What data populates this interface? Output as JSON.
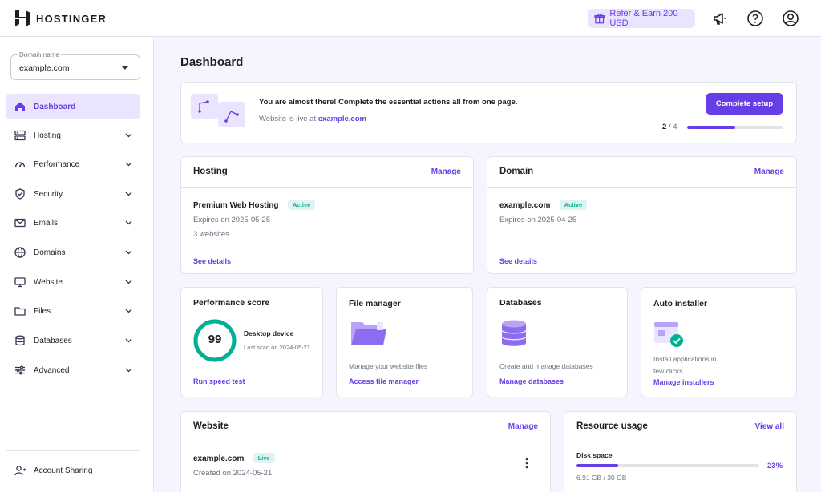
{
  "brand": {
    "name": "HOSTINGER"
  },
  "topbar": {
    "refer_label": "Refer & Earn 200 USD"
  },
  "sidebar": {
    "domain_select": {
      "label": "Domain name",
      "value": "example.com"
    },
    "items": [
      {
        "label": "Dashboard",
        "icon": "home-icon",
        "active": true
      },
      {
        "label": "Hosting",
        "icon": "server-icon"
      },
      {
        "label": "Performance",
        "icon": "gauge-icon"
      },
      {
        "label": "Security",
        "icon": "shield-icon"
      },
      {
        "label": "Emails",
        "icon": "mail-icon"
      },
      {
        "label": "Domains",
        "icon": "globe-icon"
      },
      {
        "label": "Website",
        "icon": "monitor-icon"
      },
      {
        "label": "Files",
        "icon": "folder-icon"
      },
      {
        "label": "Databases",
        "icon": "database-icon"
      },
      {
        "label": "Advanced",
        "icon": "sliders-icon"
      }
    ],
    "account_sharing": "Account Sharing"
  },
  "page": {
    "title": "Dashboard"
  },
  "setup_banner": {
    "headline": "You are almost there! Complete the essential actions all from one page.",
    "live_prefix": "Website is live at",
    "live_domain": "example.com",
    "button": "Complete setup",
    "progress_done": "2",
    "progress_total": "4",
    "progress_fraction": 0.5
  },
  "hosting_card": {
    "title": "Hosting",
    "manage": "Manage",
    "plan": "Premium Web Hosting",
    "status": "Active",
    "expires": "Expires on 2025-05-25",
    "websites": "3 websites",
    "details": "See details"
  },
  "domain_card": {
    "title": "Domain",
    "manage": "Manage",
    "name": "example.com",
    "status": "Active",
    "expires": "Expires on 2025-04-25",
    "details": "See details"
  },
  "performance_card": {
    "title": "Performance score",
    "score": "99",
    "score_fraction": 0.99,
    "device": "Desktop device",
    "last_scan": "Last scan on 2024-05-21",
    "link": "Run speed test"
  },
  "file_manager_card": {
    "title": "File manager",
    "description": "Manage your website files",
    "link": "Access file manager"
  },
  "databases_card": {
    "title": "Databases",
    "description": "Create and manage databases",
    "link": "Manage databases"
  },
  "auto_installer_card": {
    "title": "Auto installer",
    "description_line1": "Install applications in",
    "description_line2": "few clicks",
    "link": "Manage installers"
  },
  "website_card": {
    "title": "Website",
    "manage": "Manage",
    "name": "example.com",
    "status": "Live",
    "created": "Created on 2024-05-21"
  },
  "resource_card": {
    "title": "Resource usage",
    "view_all": "View all",
    "disk_label": "Disk space",
    "disk_percent": "23%",
    "disk_fraction": 0.23,
    "disk_usage": "6.91 GB / 30 GB"
  },
  "colors": {
    "accent": "#673de6",
    "accent_light": "#ebe4ff",
    "success": "#00b090"
  }
}
